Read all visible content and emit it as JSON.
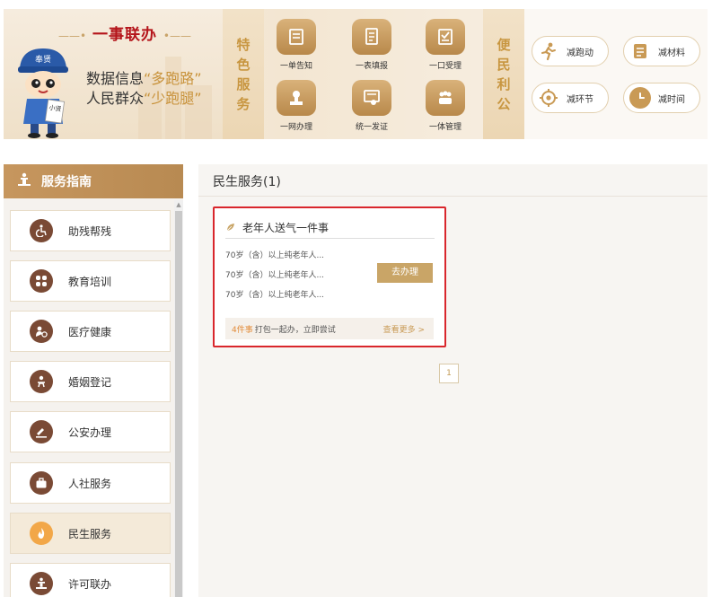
{
  "banner": {
    "title": "一事联办",
    "slogan1_prefix": "数据信息",
    "slogan1_quote": "“多跑路”",
    "slogan2_prefix": "人民群众",
    "slogan2_quote": "“少跑腿”",
    "mascot_hat": "奉贤",
    "mascot_badge": "小贤",
    "featured_label": [
      "特",
      "色",
      "服",
      "务"
    ],
    "featured": [
      {
        "label": "一单告知",
        "icon": "form-icon"
      },
      {
        "label": "一表填报",
        "icon": "document-icon"
      },
      {
        "label": "一口受理",
        "icon": "checklist-icon"
      },
      {
        "label": "一网办理",
        "icon": "stamp-icon"
      },
      {
        "label": "统一发证",
        "icon": "certificate-icon"
      },
      {
        "label": "一体管理",
        "icon": "group-icon"
      }
    ],
    "convenience_label": [
      "便",
      "民",
      "利",
      "公"
    ],
    "convenience": [
      {
        "label": "减跑动",
        "icon": "running-icon"
      },
      {
        "label": "减材料",
        "icon": "file-icon"
      },
      {
        "label": "减环节",
        "icon": "target-icon"
      },
      {
        "label": "减时间",
        "icon": "clock-icon"
      }
    ]
  },
  "sidebar": {
    "title": "服务指南",
    "items": [
      {
        "label": "助残帮残",
        "icon": "wheelchair-icon"
      },
      {
        "label": "教育培训",
        "icon": "grid-icon"
      },
      {
        "label": "医疗健康",
        "icon": "medical-icon"
      },
      {
        "label": "婚姻登记",
        "icon": "couple-icon"
      },
      {
        "label": "公安办理",
        "icon": "police-icon"
      },
      {
        "label": "人社服务",
        "icon": "briefcase-icon"
      },
      {
        "label": "民生服务",
        "icon": "flame-icon"
      },
      {
        "label": "许可联办",
        "icon": "podium-icon"
      }
    ],
    "active_index": 6
  },
  "main": {
    "title": "民生服务(1)",
    "card": {
      "title": "老年人送气一件事",
      "lines": [
        "70岁（含）以上纯老年人...",
        "70岁（含）以上纯老年人...",
        "70岁（含）以上纯老年人..."
      ],
      "button": "去办理",
      "footer_count": "4件事",
      "footer_text": "打包一起办，立即尝试",
      "footer_more": "查看更多 >"
    },
    "pagination": [
      "1"
    ]
  },
  "colors": {
    "accent": "#c9a567",
    "brand_red": "#b4141a",
    "sidebar_header": "#c6965e",
    "active_icon": "#f2a748"
  }
}
